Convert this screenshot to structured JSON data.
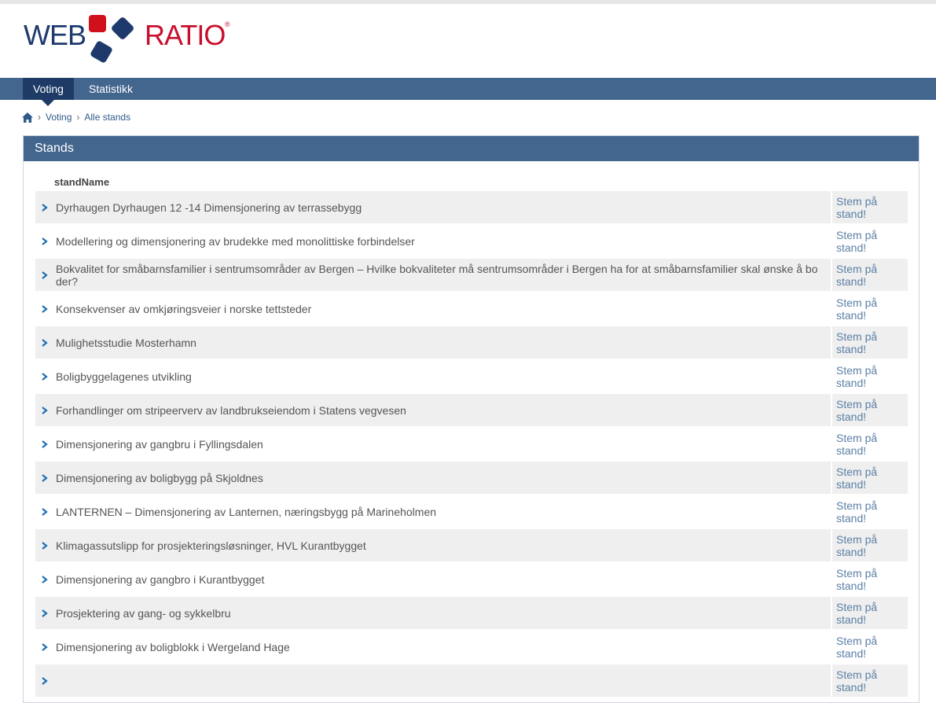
{
  "logo": {
    "word_left": "WEB",
    "word_right": "RATIO",
    "registered": "®"
  },
  "nav": {
    "tabs": [
      {
        "label": "Voting"
      },
      {
        "label": "Statistikk"
      }
    ]
  },
  "breadcrumb": {
    "items": [
      "Voting",
      "Alle stands"
    ]
  },
  "panel": {
    "title": "Stands",
    "column_header": "standName"
  },
  "action_label": "Stem på stand!",
  "rows": [
    "Dyrhaugen Dyrhaugen 12 -14 Dimensjonering av terrassebygg",
    "Modellering og dimensjonering av brudekke med monolittiske forbindelser",
    "Bokvalitet for småbarnsfamilier i sentrumsområder av Bergen – Hvilke bokvaliteter må sentrumsområder i Bergen ha for at småbarnsfamilier skal ønske å bo der?",
    "Konsekvenser av omkjøringsveier i norske tettsteder",
    "Mulighetsstudie Mosterhamn",
    "Boligbyggelagenes utvikling",
    "Forhandlinger om stripeerverv av landbrukseiendom i Statens vegvesen",
    "Dimensjonering av gangbru i Fyllingsdalen",
    "Dimensjonering av boligbygg på Skjoldnes",
    "LANTERNEN – Dimensjonering av Lanternen, næringsbygg på Marineholmen",
    "Klimagassutslipp for prosjekteringsløsninger, HVL Kurantbygget",
    "Dimensjonering av gangbro i Kurantbygget",
    "Prosjektering av gang- og sykkelbru",
    "Dimensjonering av boligblokk i Wergeland Hage",
    ""
  ],
  "colors": {
    "nav": "#43668f",
    "nav_active": "#1d3b66",
    "link": "#5b7fa6",
    "row_alt": "#efefef"
  }
}
